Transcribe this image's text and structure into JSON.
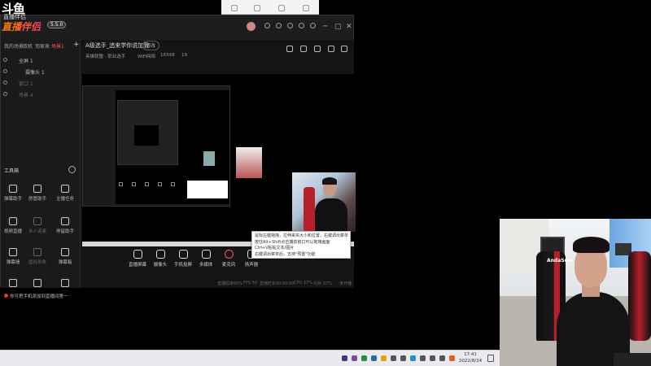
{
  "brand": {
    "logo_top": "斗鱼",
    "logo_sub": "直播伴侣",
    "logo_main": "直播伴侣",
    "badge": "5.5.0"
  },
  "window": {
    "tabs": [
      "我的场景",
      "双机",
      "司家来",
      "场景1"
    ],
    "active_tab_index": 3,
    "scenes": [
      {
        "label": "全屏 1",
        "dim": false
      },
      {
        "label": "摄像头 1",
        "dim": false
      },
      {
        "label": "窗口 1",
        "dim": true
      },
      {
        "label": "场景 4",
        "dim": true
      }
    ],
    "toolbox_title": "工具箱",
    "tools": [
      {
        "label": "弹幕助手",
        "dim": false
      },
      {
        "label": "房管助手",
        "dim": false
      },
      {
        "label": "主播任务",
        "dim": false
      },
      {
        "label": "视频直播",
        "dim": false
      },
      {
        "label": "多人连麦",
        "dim": true
      },
      {
        "label": "停留助手",
        "dim": false
      },
      {
        "label": "弹幕墙",
        "dim": false
      },
      {
        "label": "虚拟形象",
        "dim": true
      },
      {
        "label": "弹幕箱",
        "dim": false
      },
      {
        "label": "",
        "dim": false
      },
      {
        "label": "",
        "dim": false
      },
      {
        "label": "",
        "dim": false
      }
    ],
    "notice": "你可把手机添加到直播间第一"
  },
  "stream": {
    "title": "A级选手_追来学你说加我",
    "modify": "修改",
    "category": "英雄联盟 · 职业选手",
    "wifi": "WiFi网络",
    "room": "183X8",
    "fans": "19"
  },
  "bottombar": [
    {
      "label": "直播屏幕",
      "red": false
    },
    {
      "label": "摄像头",
      "red": false
    },
    {
      "label": "手机投屏",
      "red": false
    },
    {
      "label": "多媒体",
      "red": false
    },
    {
      "label": "麦克风",
      "red": true
    },
    {
      "label": "扬声器",
      "red": false
    }
  ],
  "status": {
    "s1": "直播码率60%",
    "s2": "FPS 50",
    "s3": "直播时长00:00:00",
    "s4": "CPU 37%",
    "s5": "内存 37%",
    "s6": "未开播"
  },
  "tooltip": {
    "line1": "鼠标左键拖拽，拉伸来实大小和位置，右键调出菜单",
    "line2": "按住Alt+Shift点击捕获窗口可以拖拽画面",
    "line3": "Ctrl+V粘贴文本/图片",
    "line4": "右键调出菜单后，支持\"预置\"功能"
  },
  "taskbar": {
    "time": "17:41",
    "date": "2022/8/24"
  },
  "webcam": {
    "chair_logo": "AndaSeat"
  },
  "colors": {
    "accent": "#ff5a5a",
    "panel": "#1d1d1f",
    "chair_red": "#b3202b"
  }
}
